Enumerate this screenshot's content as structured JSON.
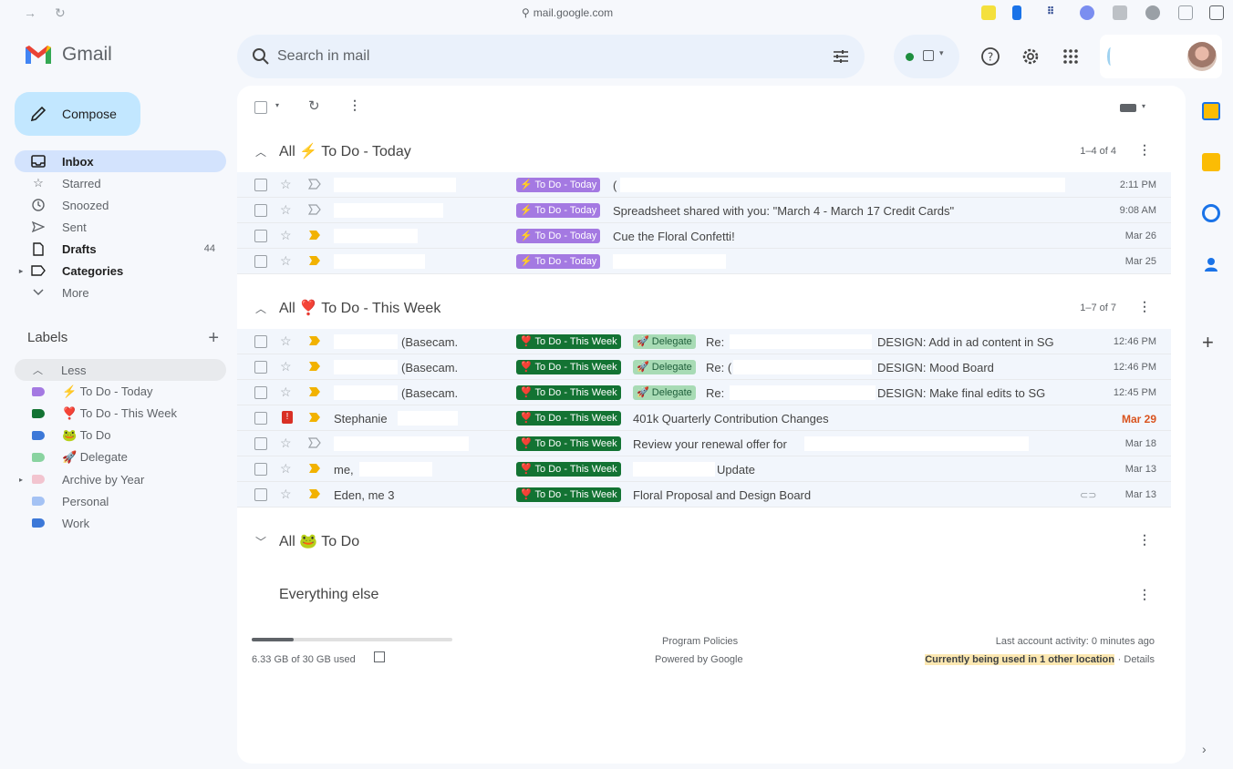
{
  "browser": {
    "url": "mail.google.com"
  },
  "app": {
    "name": "Gmail"
  },
  "search": {
    "placeholder": "Search in mail"
  },
  "compose_label": "Compose",
  "nav": [
    {
      "label": "Inbox",
      "icon": "inbox-icon",
      "active": true,
      "count": ""
    },
    {
      "label": "Starred",
      "icon": "star-icon",
      "active": false,
      "count": ""
    },
    {
      "label": "Snoozed",
      "icon": "clock-icon",
      "active": false,
      "count": ""
    },
    {
      "label": "Sent",
      "icon": "send-icon",
      "active": false,
      "count": ""
    },
    {
      "label": "Drafts",
      "icon": "draft-icon",
      "active": false,
      "count": "44"
    },
    {
      "label": "Categories",
      "icon": "label-icon",
      "active": false,
      "count": ""
    },
    {
      "label": "More",
      "icon": "chevron-down-icon",
      "active": false,
      "count": ""
    }
  ],
  "labels_title": "Labels",
  "labels": [
    {
      "label": "Less",
      "color": ""
    },
    {
      "label": "⚡ To Do - Today",
      "color": "#a479e2"
    },
    {
      "label": "❣️ To Do - This Week",
      "color": "#137333"
    },
    {
      "label": "🐸 To Do",
      "color": "#3c78d8"
    },
    {
      "label": "🚀 Delegate",
      "color": "#89d3a0"
    },
    {
      "label": "Archive by Year",
      "color": "#f2c4cf"
    },
    {
      "label": "Personal",
      "color": "#a4c2f4"
    },
    {
      "label": "Work",
      "color": "#3c78d8"
    }
  ],
  "sections": {
    "today": {
      "title": "All ⚡ To Do - Today",
      "range": "1–4 of 4",
      "rows": [
        {
          "sender": "",
          "chips": [
            "⚡ To Do - Today"
          ],
          "subject": "(",
          "date": "2:11 PM"
        },
        {
          "sender": "",
          "chips": [
            "⚡ To Do - Today"
          ],
          "subject": "Spreadsheet shared with you: \"March 4 - March 17 Credit Cards\"",
          "date": "9:08 AM"
        },
        {
          "sender": "",
          "chips": [
            "⚡ To Do - Today"
          ],
          "subject": "Cue the Floral Confetti!",
          "date": "Mar 26"
        },
        {
          "sender": "",
          "chips": [
            "⚡ To Do - Today"
          ],
          "subject": "",
          "date": "Mar 25"
        }
      ]
    },
    "week": {
      "title": "All ❣️ To Do - This Week",
      "range": "1–7 of 7",
      "rows": [
        {
          "sender": "(Basecam.",
          "chips": [
            "❣️ To Do - This Week",
            "🚀 Delegate"
          ],
          "re": "Re:",
          "subject": "DESIGN: Add in ad content in SG",
          "date": "12:46 PM"
        },
        {
          "sender": "(Basecam.",
          "chips": [
            "❣️ To Do - This Week",
            "🚀 Delegate"
          ],
          "re": "Re: (",
          "subject": "DESIGN: Mood Board",
          "date": "12:46 PM"
        },
        {
          "sender": "(Basecam.",
          "chips": [
            "❣️ To Do - This Week",
            "🚀 Delegate"
          ],
          "re": "Re:",
          "subject": "DESIGN: Make final edits to SG",
          "date": "12:45 PM"
        },
        {
          "sender": "Stephanie",
          "chips": [
            "❣️ To Do - This Week"
          ],
          "re": "",
          "subject": "401k Quarterly Contribution Changes",
          "date": "Mar 29"
        },
        {
          "sender": "",
          "chips": [
            "❣️ To Do - This Week"
          ],
          "re": "",
          "subject": "Review your renewal offer for",
          "date": "Mar 18"
        },
        {
          "sender": "me,",
          "chips": [
            "❣️ To Do - This Week"
          ],
          "re": "",
          "subject": "Update",
          "date": "Mar 13"
        },
        {
          "sender": "Eden, me 3",
          "chips": [
            "❣️ To Do - This Week"
          ],
          "re": "",
          "subject": "Floral Proposal and Design Board",
          "date": "Mar 13"
        }
      ]
    },
    "todo": {
      "title": "All 🐸 To Do"
    },
    "else": {
      "title": "Everything else"
    }
  },
  "footer": {
    "storage_text": "6.33 GB of 30 GB used",
    "storage_fraction": 0.211,
    "policies": "Program Policies",
    "powered": "Powered by Google",
    "activity": "Last account activity: 0 minutes ago",
    "other_location": "Currently being used in 1 other location",
    "details": "· Details"
  },
  "colors": {
    "accent": "#c2e7ff",
    "active_nav": "#d3e3fd",
    "today_chip": "#a479e2",
    "week_chip": "#137333",
    "delegate_chip": "#a8dbb5",
    "highlight": "#fce8b2"
  }
}
